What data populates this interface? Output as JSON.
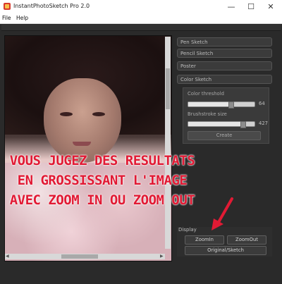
{
  "window": {
    "title": "InstantPhotoSketch Pro 2.0",
    "minimize_symbol": "—",
    "maximize_symbol": "☐",
    "close_symbol": "✕"
  },
  "menu": {
    "items": [
      "File",
      "Help"
    ]
  },
  "overlay_text": [
    "VOUS JUGEZ DES RESULTATS",
    "EN GROSSISSANT L'IMAGE",
    "AVEC ZOOM IN OU ZOOM OUT"
  ],
  "panel": {
    "buttons": [
      "Pen Sketch",
      "Pencil Sketch",
      "Poster",
      "Color Sketch"
    ],
    "color_sketch": {
      "color_threshold_label": "Color threshold",
      "color_threshold_value": "64",
      "color_threshold_fraction": 0.64,
      "brushstroke_label": "Brushstroke size",
      "brushstroke_value": "427",
      "brushstroke_fraction": 0.82,
      "create_label": "Create"
    },
    "display": {
      "label": "Display",
      "zoom_in": "ZoomIn",
      "zoom_out": "ZoomOut",
      "original_sketch": "Original/Sketch"
    }
  },
  "colors": {
    "overlay_text": "#e11a34",
    "arrow": "#e11a34"
  },
  "icons": [
    "app-icon",
    "minimize-icon",
    "maximize-icon",
    "close-icon",
    "red-arrow-icon"
  ]
}
